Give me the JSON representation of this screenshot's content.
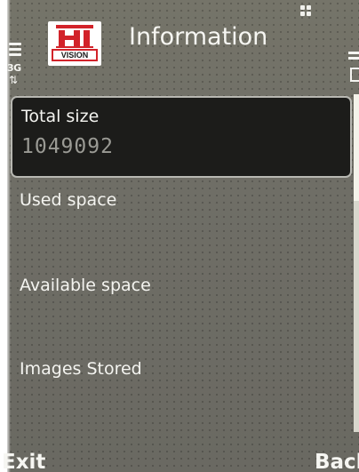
{
  "header": {
    "title": "Information",
    "network": "3G",
    "network_arrows": "⇅",
    "app_logo": {
      "top_text": "HI",
      "bottom_text": "VISION",
      "brand_color": "#d2232a"
    },
    "menu_icon": "grid-menu-icon"
  },
  "list": {
    "items": [
      {
        "label": "Total size",
        "value": "1049092",
        "selected": true
      },
      {
        "label": "Used space",
        "value": "",
        "selected": false
      },
      {
        "label": "Available space",
        "value": "",
        "selected": false
      },
      {
        "label": "Images Stored",
        "value": "",
        "selected": false
      }
    ]
  },
  "softkeys": {
    "left": "Exit",
    "right": "Back"
  },
  "colors": {
    "background": "#6e6d66",
    "selected_row": "#1c1c1a",
    "text": "#f4f4f0",
    "value_text": "#9a9a94"
  }
}
